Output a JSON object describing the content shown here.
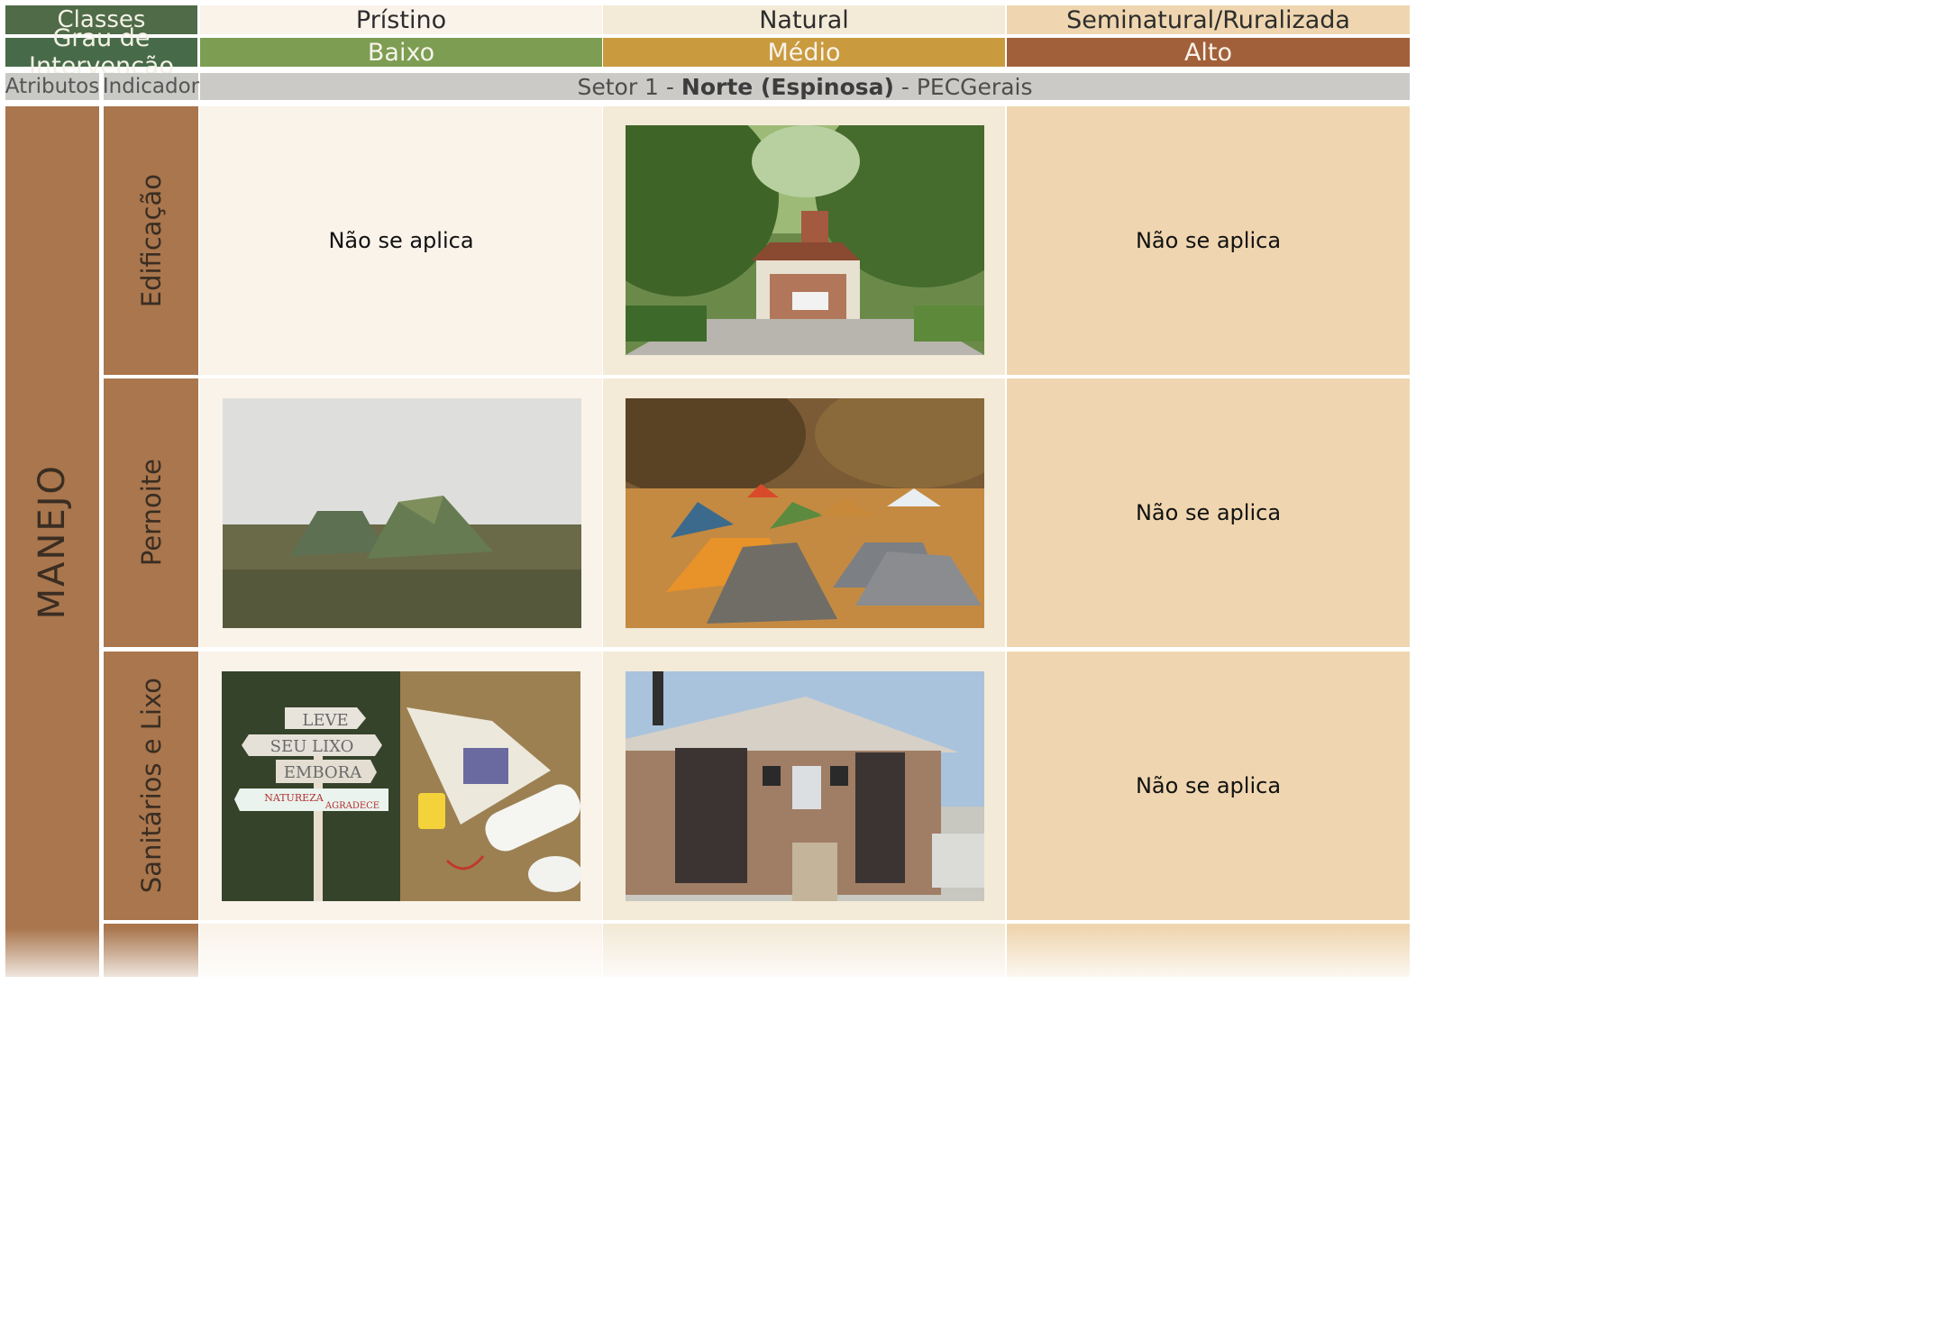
{
  "header": {
    "classes_label": "Classes",
    "classes": [
      "Prístino",
      "Natural",
      "Seminatural/Ruralizada"
    ],
    "grau_label": "Grau de Intervenção",
    "levels": [
      "Baixo",
      "Médio",
      "Alto"
    ],
    "atributos_label": "Atributos",
    "indicador_label": "Indicador",
    "sector_prefix": "Setor 1 - ",
    "sector_bold": "Norte (Espinosa)",
    "sector_suffix": " - PECGerais"
  },
  "colors": {
    "baixo": "#7c9d52",
    "medio": "#c99a3e",
    "alto": "#a2603a",
    "brown_band": "#a9764d",
    "dark_green": "#4f6b48"
  },
  "attribute": "MANEJO",
  "rows": [
    {
      "indicator": "Edificação",
      "pristino_text": "Não se aplica",
      "pristino_photo": "",
      "natural_photo": "park-entrance-building-photo",
      "seminatural_text": "Não se aplica"
    },
    {
      "indicator": "Pernoite",
      "pristino_text": "",
      "pristino_photo": "tents-in-fog-photo",
      "natural_photo": "campsite-tents-photo",
      "seminatural_text": "Não se aplica"
    },
    {
      "indicator": "Sanitários e Lixo",
      "pristino_text": "",
      "pristino_photo": "trash-sign-and-waste-photo",
      "natural_photo": "restroom-building-photo",
      "seminatural_text": "Não se aplica"
    }
  ],
  "sign_text": {
    "line1": "LEVE",
    "line2": "SEU LIXO",
    "line3": "EMBORA",
    "line4": "NATUREZA",
    "line5": "AGRADECE"
  }
}
